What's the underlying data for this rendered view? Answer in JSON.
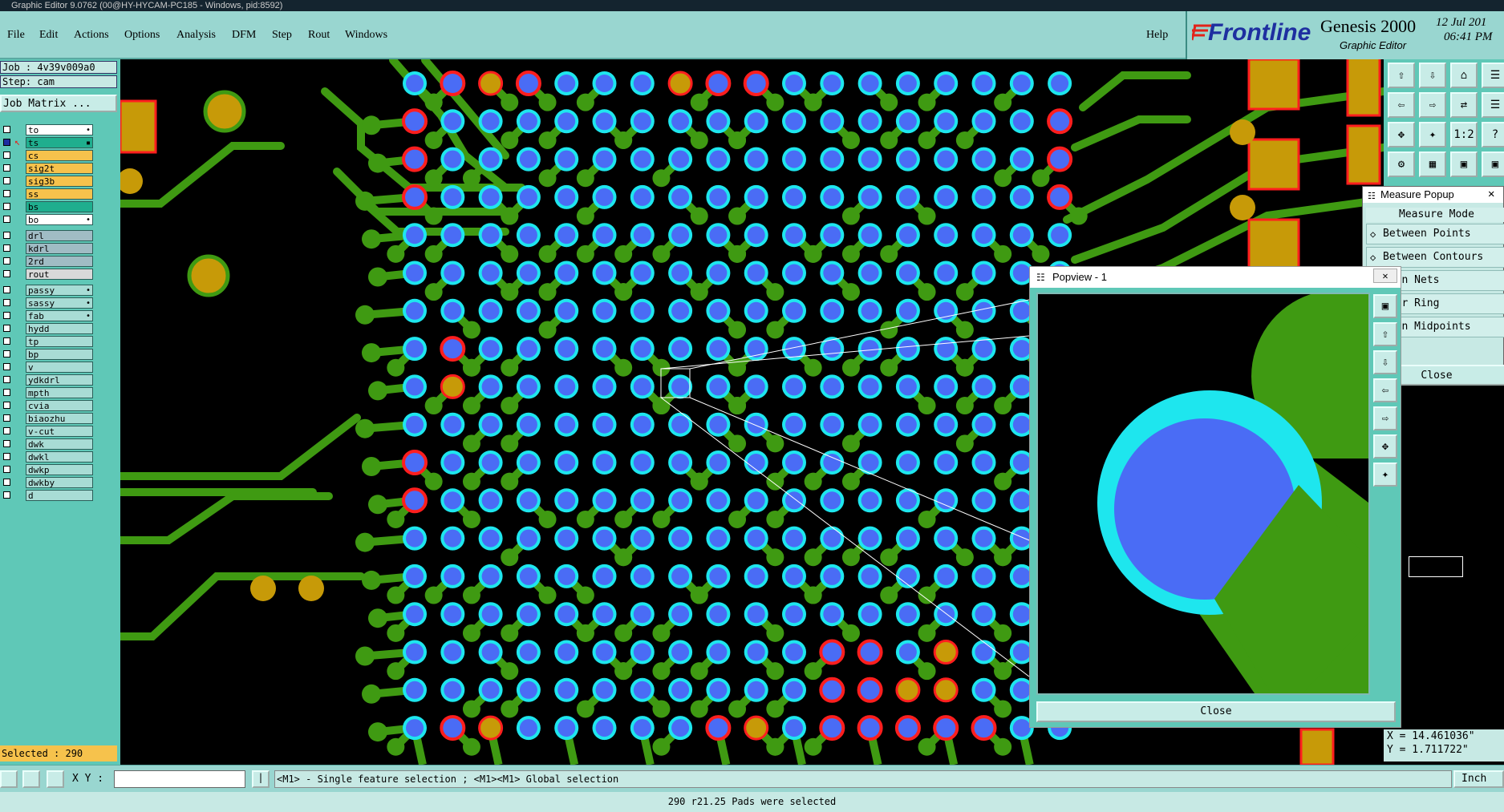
{
  "window_title": "Graphic Editor 9.0762 (00@HY-HYCAM-PC185 - Windows, pid:8592)",
  "menu": [
    "File",
    "Edit",
    "Actions",
    "Options",
    "Analysis",
    "DFM",
    "Step",
    "Rout",
    "Windows"
  ],
  "help_label": "Help",
  "brand": {
    "logo_text": "Frontline",
    "product": "Genesis 2000",
    "subtitle": "Graphic Editor",
    "date": "12 Jul 201",
    "time": "06:41 PM"
  },
  "job": {
    "job_label": "Job : 4v39v009a0",
    "step_label": "Step: cam",
    "matrix_button": "Job Matrix ..."
  },
  "layers": [
    {
      "name": "to",
      "color": "#ffffff",
      "flag": "•"
    },
    {
      "name": "ts",
      "color": "#1fae8e",
      "flag": "▪",
      "active": true
    },
    {
      "name": "cs",
      "color": "#f6c24c"
    },
    {
      "name": "sig2t",
      "color": "#f6c24c"
    },
    {
      "name": "sig3b",
      "color": "#f6c24c"
    },
    {
      "name": "ss",
      "color": "#f6c24c"
    },
    {
      "name": "bs",
      "color": "#1fae8e"
    },
    {
      "name": "bo",
      "color": "#ffffff",
      "flag": "•"
    },
    {
      "name": "drl",
      "color": "#a0bcc4"
    },
    {
      "name": "kdrl",
      "color": "#a0bcc4"
    },
    {
      "name": "2rd",
      "color": "#a0bcc4"
    },
    {
      "name": "rout",
      "color": "#d9d9d9"
    },
    {
      "name": "passy",
      "color": "#a8dcd5",
      "flag": "•"
    },
    {
      "name": "sassy",
      "color": "#a8dcd5",
      "flag": "•"
    },
    {
      "name": "fab",
      "color": "#a8dcd5",
      "flag": "•"
    },
    {
      "name": "hydd",
      "color": "#a8dcd5"
    },
    {
      "name": "tp",
      "color": "#a8dcd5"
    },
    {
      "name": "bp",
      "color": "#a8dcd5"
    },
    {
      "name": "v",
      "color": "#a8dcd5"
    },
    {
      "name": "ydkdrl",
      "color": "#a8dcd5"
    },
    {
      "name": "mpth",
      "color": "#a8dcd5"
    },
    {
      "name": "cvia",
      "color": "#a8dcd5"
    },
    {
      "name": "biaozhu",
      "color": "#a8dcd5"
    },
    {
      "name": "v-cut",
      "color": "#a8dcd5"
    },
    {
      "name": "dwk",
      "color": "#a8dcd5"
    },
    {
      "name": "dwkl",
      "color": "#a8dcd5"
    },
    {
      "name": "dwkp",
      "color": "#a8dcd5"
    },
    {
      "name": "dwkby",
      "color": "#a8dcd5"
    },
    {
      "name": "d",
      "color": "#a8dcd5"
    }
  ],
  "selected_label": "Selected : 290",
  "measure_popup": {
    "title": "Measure Popup",
    "heading": "Measure Mode",
    "modes": [
      "Between Points",
      "Between Contours",
      "ween Nets",
      "ular Ring",
      "ween Midpoints"
    ],
    "close_label": "Close"
  },
  "popview": {
    "title": "Popview - 1",
    "close_label": "Close"
  },
  "coordinates": {
    "x": "X = 14.461036\"",
    "y": "Y = 1.711722\""
  },
  "command_bar": {
    "xy_label": "X Y :",
    "hint": "<M1> - Single feature selection ; <M1><M1> Global selection",
    "units": "Inch"
  },
  "status_message": "290 r21.25 Pads were selected",
  "colors": {
    "panel": "#5fc8b7",
    "menubar": "#99d6d0",
    "trace": "#3f9a12",
    "pad_fill": "#4a6cf5",
    "pad_ring": "#1ee6ee",
    "red_pad": "#ff1e1e",
    "gold_pad": "#c79a08"
  }
}
